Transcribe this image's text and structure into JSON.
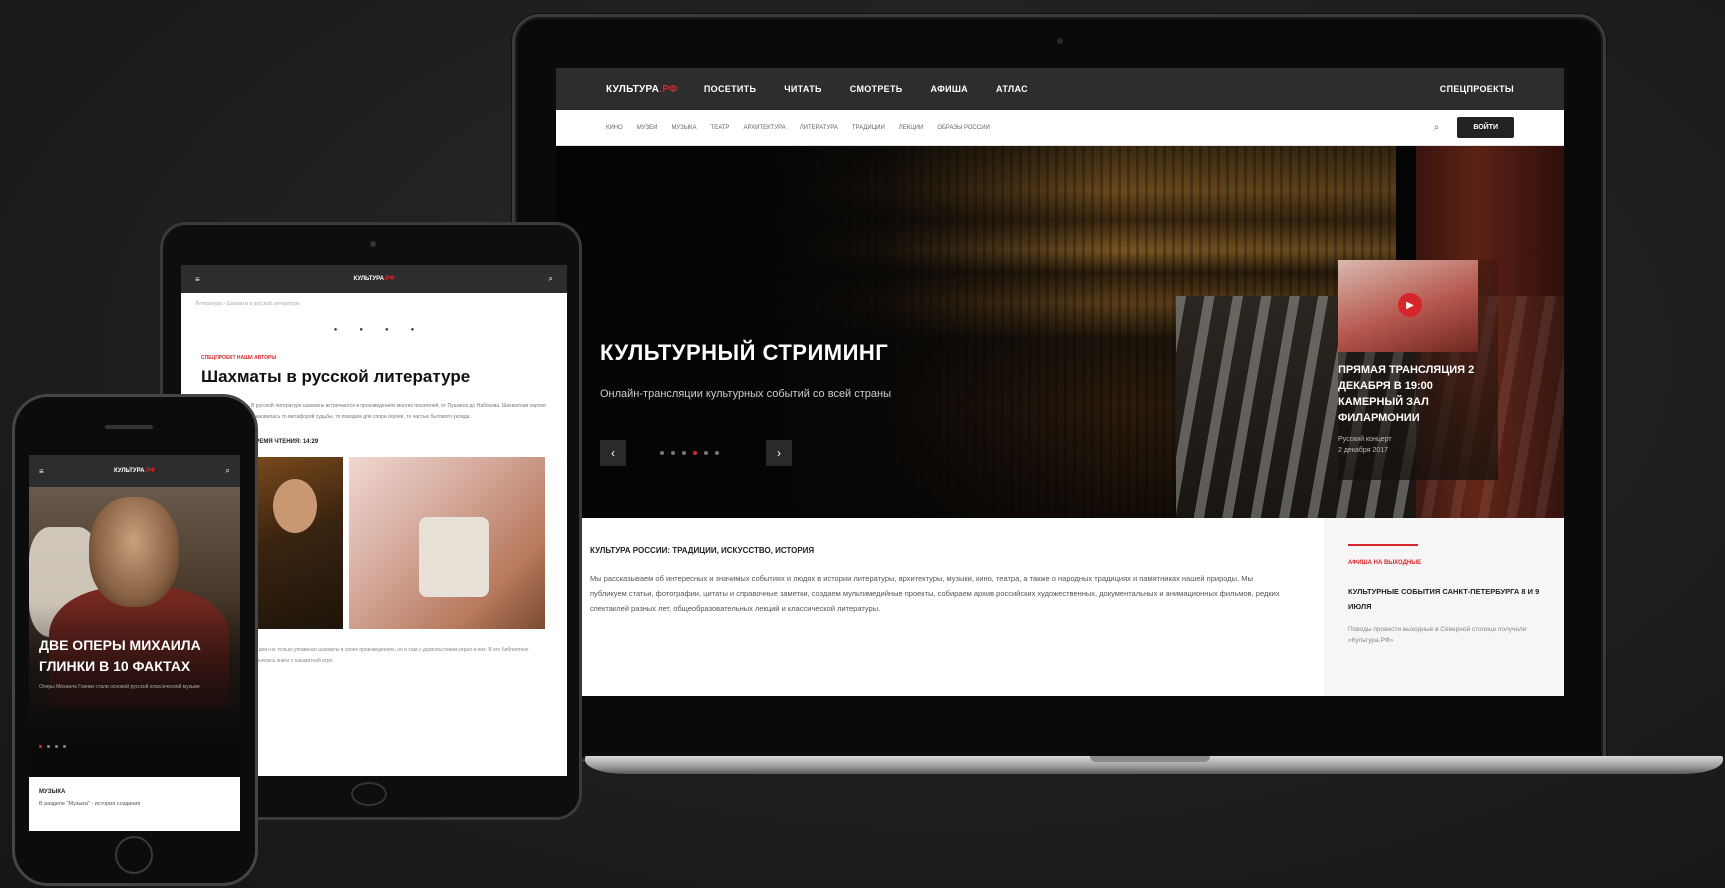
{
  "laptop": {
    "logo": {
      "main": "КУЛЬТУРА",
      "accent": ".РФ"
    },
    "top_nav": [
      "ПОСЕТИТЬ",
      "ЧИТАТЬ",
      "СМОТРЕТЬ",
      "АФИША",
      "АТЛАС"
    ],
    "special": "СПЕЦПРОЕКТЫ",
    "sub_nav": [
      "КИНО",
      "МУЗЕИ",
      "МУЗЫКА",
      "ТЕАТР",
      "АРХИТЕКТУРА",
      "ЛИТЕРАТУРА",
      "ТРАДИЦИИ",
      "ЛЕКЦИИ",
      "ОБРАЗЫ РОССИИ"
    ],
    "search_icon": "search-icon",
    "login_label": "ВОЙТИ",
    "hero": {
      "title": "КУЛЬТУРНЫЙ СТРИМИНГ",
      "subtitle": "Онлайн-трансляции культурных событий со всей страны",
      "prev": "‹",
      "next": "›",
      "slide_count": 6,
      "active_slide": 4
    },
    "hero_card": {
      "play_icon": "play-icon",
      "title": "ПРЯМАЯ ТРАНСЛЯЦИЯ 2 ДЕКАБРЯ В 19:00 КАМЕРНЫЙ ЗАЛ ФИЛАРМОНИИ",
      "meta": [
        "Русский концерт",
        "2 декабря 2017"
      ]
    },
    "lower": {
      "title": "КУЛЬТУРА РОССИИ: ТРАДИЦИИ, ИСКУССТВО, ИСТОРИЯ",
      "text": "Мы рассказываем об интересных и значимых событиях и людях в истории литературы, архитектуры, музыки, кино, театра, а также о народных традициях и памятниках нашей природы. Мы публикуем статьи, фотографии, цитаты и справочные заметки, создаем мультимедийные проекты, собираем архив российских художественных, документальных и анимационных фильмов, редких спектаклей разных лет, общеобразовательных лекций и классической литературы."
    },
    "aside": {
      "kicker": "АФИША НА ВЫХОДНЫЕ",
      "title": "КУЛЬТУРНЫЕ СОБЫТИЯ САНКТ-ПЕТЕРБУРГА 8 И 9 ИЮЛЯ",
      "text": "Поводы провести выходные в Северной столице получили «Культура.РФ»"
    }
  },
  "tablet": {
    "logo": {
      "main": "КУЛЬТУРА",
      "accent": ".РФ"
    },
    "menu_icon": "≡",
    "search_icon": "⌕",
    "breadcrumb": "Литература › Шахматы в русской литературе",
    "share": [
      "●",
      "●",
      "●",
      "●"
    ],
    "kicker": "СПЕЦПРОЕКТ НАШИ АВТОРЫ",
    "title": "Шахматы в русской литературе",
    "text": "В русской литературе шахматы встречаются в произведениях многих писателей, от Пушкина до Набокова. Шахматная партия становилась то метафорой судьбы, то поводом для спора героев, то частью бытового уклада.",
    "time": "ВРЕМЯ ЧТЕНИЯ: 14:29",
    "bottom_text": "Пушкин не только упоминал шахматы в своих произведениях, но и сам с удовольствием играл в них. В его библиотеке хранились книги о шахматной игре."
  },
  "phone": {
    "logo": {
      "main": "КУЛЬТУРА",
      "accent": ".РФ"
    },
    "menu_icon": "≡",
    "search_icon": "⌕",
    "hero_title": "ДВЕ ОПЕРЫ МИХАИЛА ГЛИНКИ В 10 ФАКТАХ",
    "hero_sub": "Оперы Михаила Глинки стали основой русской классической музыки",
    "kicker": "МУЗЫКА",
    "text": "В разделе \"Музыка\" - история создания"
  }
}
